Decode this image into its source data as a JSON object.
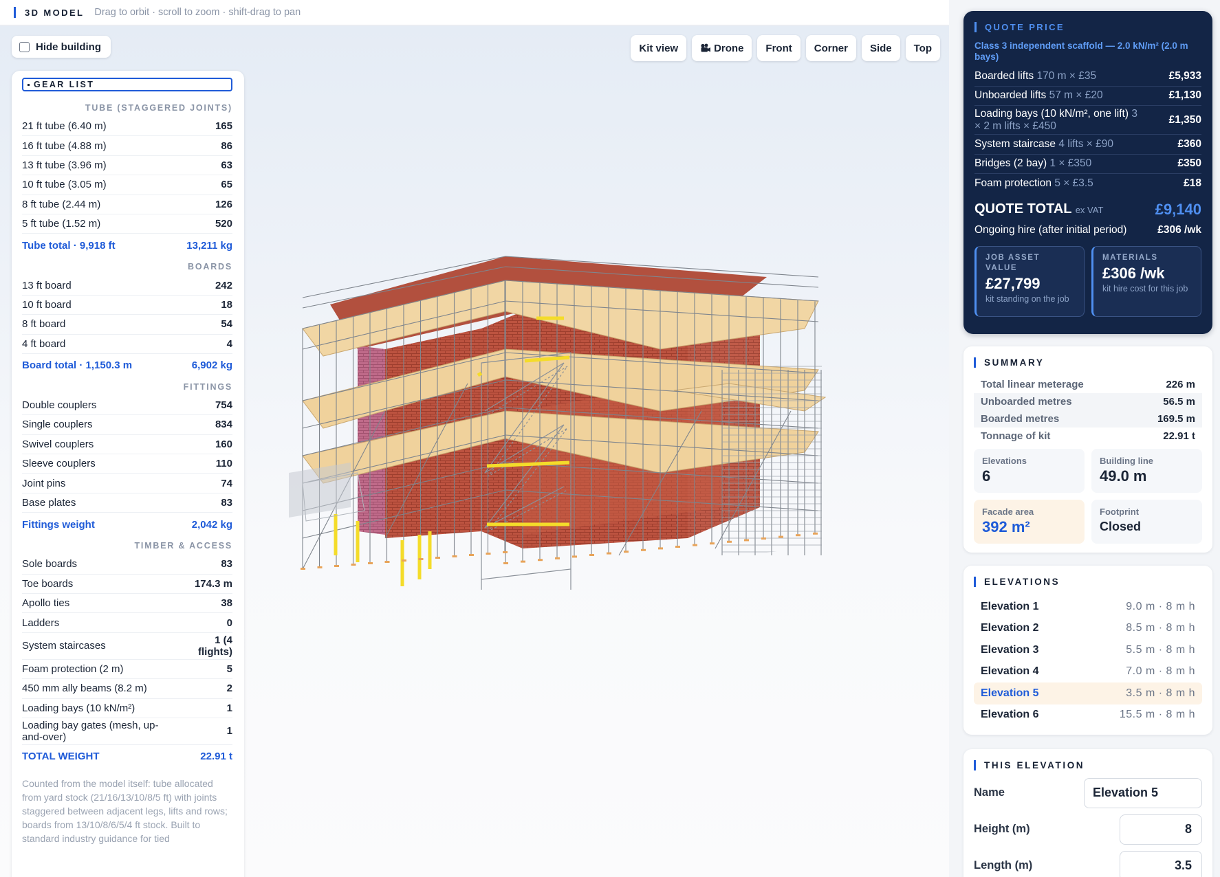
{
  "topbar": {
    "title": "3D MODEL",
    "hint": "Drag to orbit · scroll to zoom · shift-drag to pan"
  },
  "viewport": {
    "hide_building": "Hide building",
    "hide_building_checked": false,
    "views": [
      "Kit view",
      "Drone",
      "Front",
      "Corner",
      "Side",
      "Top"
    ],
    "drone_icon": "camera-icon"
  },
  "gear": {
    "title": "GEAR LIST",
    "tube_heading": "TUBE (STAGGERED JOINTS)",
    "tubes": [
      {
        "label": "21 ft tube (6.40 m)",
        "value": "165"
      },
      {
        "label": "16 ft tube (4.88 m)",
        "value": "86"
      },
      {
        "label": "13 ft tube (3.96 m)",
        "value": "63"
      },
      {
        "label": "10 ft tube (3.05 m)",
        "value": "65"
      },
      {
        "label": "8 ft tube (2.44 m)",
        "value": "126"
      },
      {
        "label": "5 ft tube (1.52 m)",
        "value": "520"
      }
    ],
    "tube_total": {
      "label": "Tube total · 9,918 ft",
      "value": "13,211 kg"
    },
    "boards_heading": "BOARDS",
    "boards": [
      {
        "label": "13 ft board",
        "value": "242"
      },
      {
        "label": "10 ft board",
        "value": "18"
      },
      {
        "label": "8 ft board",
        "value": "54"
      },
      {
        "label": "4 ft board",
        "value": "4"
      }
    ],
    "board_total": {
      "label": "Board total · 1,150.3 m",
      "value": "6,902 kg"
    },
    "fittings_heading": "FITTINGS",
    "fittings": [
      {
        "label": "Double couplers",
        "value": "754"
      },
      {
        "label": "Single couplers",
        "value": "834"
      },
      {
        "label": "Swivel couplers",
        "value": "160"
      },
      {
        "label": "Sleeve couplers",
        "value": "110"
      },
      {
        "label": "Joint pins",
        "value": "74"
      },
      {
        "label": "Base plates",
        "value": "83"
      }
    ],
    "fittings_total": {
      "label": "Fittings weight",
      "value": "2,042 kg"
    },
    "timber_heading": "TIMBER & ACCESS",
    "timber": [
      {
        "label": "Sole boards",
        "value": "83"
      },
      {
        "label": "Toe boards",
        "value": "174.3 m"
      },
      {
        "label": "Apollo ties",
        "value": "38"
      },
      {
        "label": "Ladders",
        "value": "0"
      },
      {
        "label": "System staircases",
        "value": "1 (4 flights)"
      },
      {
        "label": "Foam protection (2 m)",
        "value": "5"
      },
      {
        "label": "450 mm ally beams (8.2 m)",
        "value": "2"
      },
      {
        "label": "Loading bays (10 kN/m²)",
        "value": "1"
      },
      {
        "label": "Loading bay gates (mesh, up-and-over)",
        "value": "1"
      }
    ],
    "grand_total": {
      "label": "TOTAL WEIGHT",
      "value": "22.91 t"
    },
    "note": "Counted from the model itself: tube allocated from yard stock (21/16/13/10/8/5 ft) with joints staggered between adjacent legs, lifts and rows; boards from 13/10/8/6/5/4 ft stock. Built to standard industry guidance for tied"
  },
  "quote": {
    "heading": "QUOTE PRICE",
    "subtitle": "Class 3 independent scaffold — 2.0 kN/m² (2.0 m bays)",
    "lines": [
      {
        "label": "Boarded lifts",
        "detail": "170 m × £35",
        "value": "£5,933"
      },
      {
        "label": "Unboarded lifts",
        "detail": "57 m × £20",
        "value": "£1,130"
      },
      {
        "label": "Loading bays (10 kN/m², one lift)",
        "detail": "3 × 2 m lifts × £450",
        "value": "£1,350"
      },
      {
        "label": "System staircase",
        "detail": "4 lifts × £90",
        "value": "£360"
      },
      {
        "label": "Bridges (2 bay)",
        "detail": "1 × £350",
        "value": "£350"
      },
      {
        "label": "Foam protection",
        "detail": "5 × £3.5",
        "value": "£18"
      }
    ],
    "total_label": "QUOTE TOTAL",
    "total_suffix": "ex VAT",
    "total_value": "£9,140",
    "ongoing_label": "Ongoing hire (after initial period)",
    "ongoing_value": "£306 /wk",
    "cards": [
      {
        "key": "JOB ASSET VALUE",
        "value": "£27,799",
        "sub": "kit standing on the job"
      },
      {
        "key": "MATERIALS",
        "value": "£306 /wk",
        "sub": "kit hire cost for this job"
      }
    ]
  },
  "summary": {
    "heading": "SUMMARY",
    "rows": [
      {
        "label": "Total linear meterage",
        "value": "226 m"
      },
      {
        "label": "Unboarded metres",
        "value": "56.5 m"
      },
      {
        "label": "Boarded metres",
        "value": "169.5 m"
      },
      {
        "label": "Tonnage of kit",
        "value": "22.91 t"
      }
    ],
    "tiles": [
      {
        "key": "Elevations",
        "value": "6"
      },
      {
        "key": "Building line",
        "value": "49.0 m"
      },
      {
        "key": "Facade area",
        "value": "392 m²"
      },
      {
        "key": "Footprint",
        "value": "Closed"
      }
    ]
  },
  "elevations": {
    "heading": "ELEVATIONS",
    "items": [
      {
        "name": "Elevation 1",
        "dims": "9.0 m · 8 m h"
      },
      {
        "name": "Elevation 2",
        "dims": "8.5 m · 8 m h"
      },
      {
        "name": "Elevation 3",
        "dims": "5.5 m · 8 m h"
      },
      {
        "name": "Elevation 4",
        "dims": "7.0 m · 8 m h"
      },
      {
        "name": "Elevation 5",
        "dims": "3.5 m · 8 m h"
      },
      {
        "name": "Elevation 6",
        "dims": "15.5 m · 8 m h"
      }
    ],
    "selected": "Elevation 5"
  },
  "this_elevation": {
    "heading": "THIS ELEVATION",
    "name_label": "Name",
    "name_value": "Elevation 5",
    "height_label": "Height (m)",
    "height_value": "8",
    "length_label": "Length (m)",
    "length_value": "3.5"
  },
  "colors": {
    "accent": "#1f5bd8",
    "navy": "#132546",
    "brick": "#b94a38",
    "board": "#f1d6a4",
    "yellow": "#f4dc2a"
  }
}
